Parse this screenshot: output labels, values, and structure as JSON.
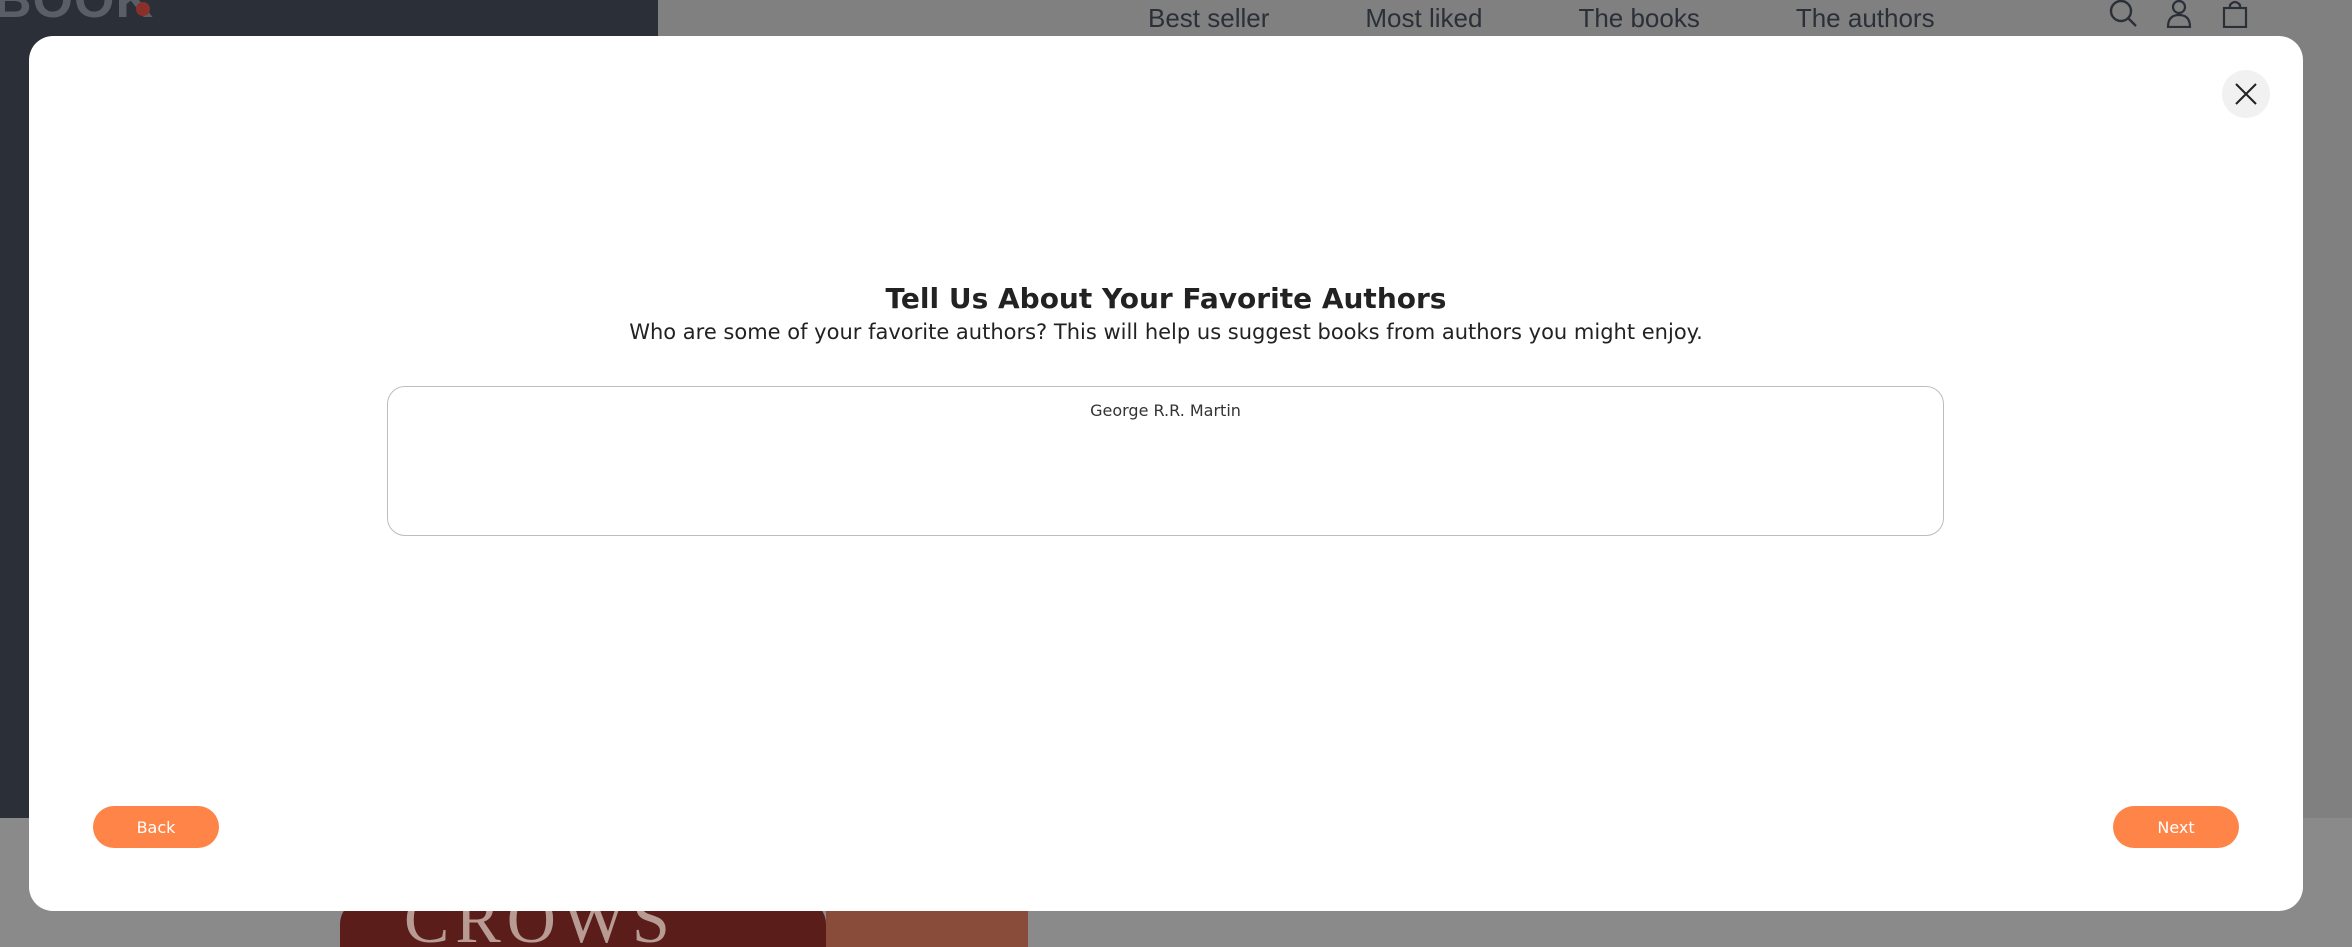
{
  "background": {
    "logo_text": "BOOK",
    "nav": [
      "Best seller",
      "Most liked",
      "The books",
      "The authors"
    ],
    "icons": [
      "search-icon",
      "user-icon",
      "cart-icon"
    ],
    "book_cover_text": "CROWS"
  },
  "modal": {
    "title": "Tell Us About Your Favorite Authors",
    "subtitle": "Who are some of your favorite authors? This will help us suggest books from authors you might enjoy.",
    "authors_value": "George R.R. Martin",
    "back_label": "Back",
    "next_label": "Next",
    "close_icon": "close-icon"
  },
  "colors": {
    "accent": "#ff8447",
    "overlay": "#808080",
    "dark_panel": "#2a2f38"
  }
}
